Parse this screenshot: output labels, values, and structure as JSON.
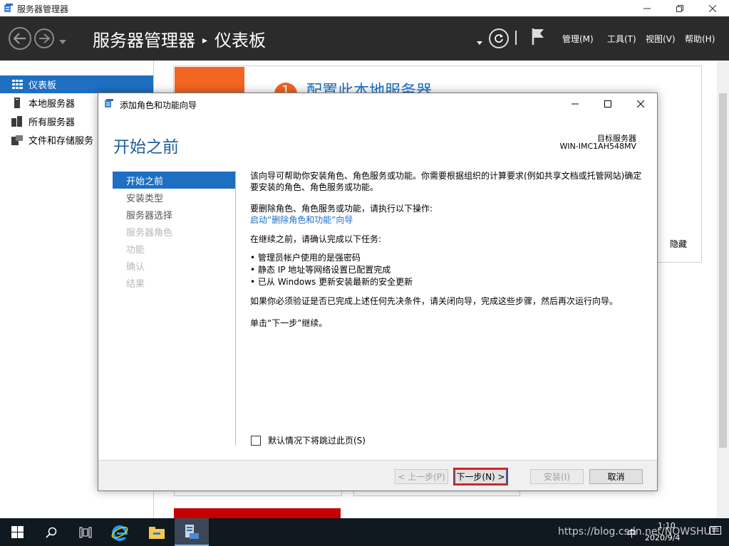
{
  "outer_window": {
    "title": "服务器管理器"
  },
  "header": {
    "breadcrumb_root": "服务器管理器",
    "breadcrumb_sep": "▸",
    "breadcrumb_page": "仪表板",
    "menu": {
      "manage": "管理(M)",
      "tools": "工具(T)",
      "view": "视图(V)",
      "help": "帮助(H)"
    }
  },
  "sidebar": {
    "items": [
      {
        "label": "仪表板",
        "active": true
      },
      {
        "label": "本地服务器"
      },
      {
        "label": "所有服务器"
      },
      {
        "label": "文件和存储服务"
      }
    ]
  },
  "dashboard": {
    "hide_label": "隐藏",
    "step_number": "1",
    "step_title": "配置此本地服务器"
  },
  "wizard": {
    "title": "添加角色和功能向导",
    "heading": "开始之前",
    "target_server_label": "目标服务器",
    "target_server_name": "WIN-IMC1AH548MV",
    "steps": [
      {
        "label": "开始之前",
        "state": "active"
      },
      {
        "label": "安装类型",
        "state": "normal"
      },
      {
        "label": "服务器选择",
        "state": "normal"
      },
      {
        "label": "服务器角色",
        "state": "disabled"
      },
      {
        "label": "功能",
        "state": "disabled"
      },
      {
        "label": "确认",
        "state": "disabled"
      },
      {
        "label": "结果",
        "state": "disabled"
      }
    ],
    "content": {
      "intro": "该向导可帮助你安装角色、角色服务或功能。你需要根据组织的计算要求(例如共享文档或托管网站)确定要安装的角色、角色服务或功能。",
      "remove_text": "要删除角色、角色服务或功能，请执行以下操作:",
      "remove_link": "启动“删除角色和功能”向导",
      "before_continue": "在继续之前，请确认完成以下任务:",
      "tasks": [
        "• 管理员帐户使用的是强密码",
        "• 静态 IP 地址等网络设置已配置完成",
        "• 已从 Windows 更新安装最新的安全更新"
      ],
      "verify_text": "如果你必须验证是否已完成上述任何先决条件，请关闭向导，完成这些步骤，然后再次运行向导。",
      "click_next": "单击“下一步”继续。"
    },
    "skip_checkbox_label": "默认情况下将跳过此页(S)",
    "buttons": {
      "prev": "< 上一步(P)",
      "next": "下一步(N) >",
      "install": "安装(I)",
      "cancel": "取消"
    }
  },
  "taskbar": {
    "tray_text": "https://blog.csdn.net/NOWSHUT",
    "ime": "中",
    "time": "1:10",
    "date": "2020/9/4"
  },
  "colors": {
    "accent_blue": "#1e6fc2",
    "header_bg": "#2b2b2b",
    "tile_orange": "#f26522",
    "tile_red": "#c60000",
    "highlight_red": "#d42020"
  }
}
